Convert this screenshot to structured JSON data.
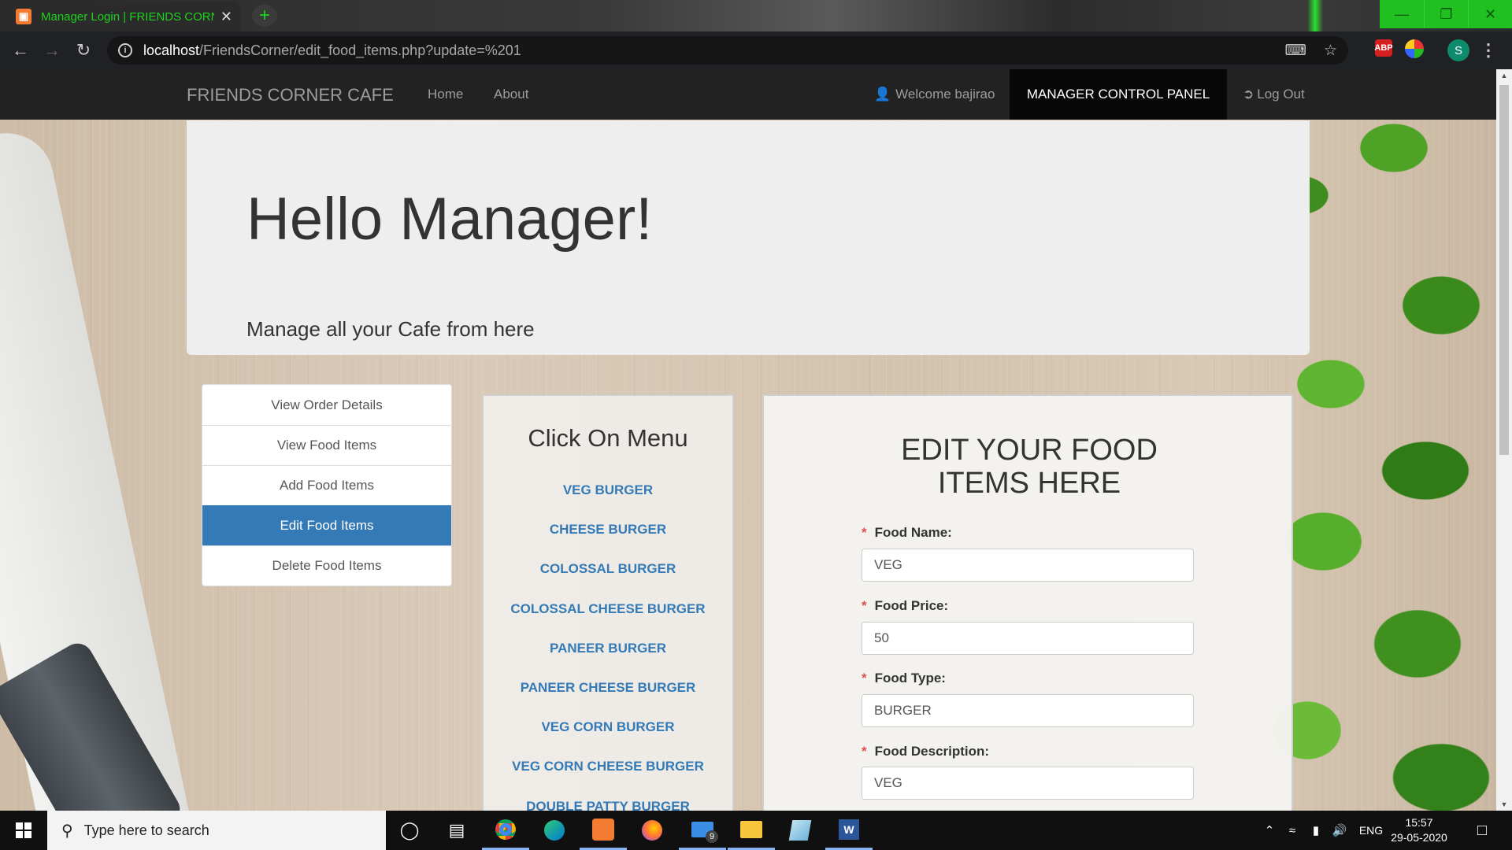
{
  "browser": {
    "tab_title": "Manager Login | FRIENDS CORNER",
    "tab_favicon": "xampp-icon",
    "new_tab_symbol": "+",
    "url_host": "localhost",
    "url_path": "/FriendsCorner/edit_food_items.php?update=%201",
    "extensions": {
      "abp_label": "ABP",
      "profile_initial": "S"
    },
    "accent_color": "#20c020"
  },
  "navbar": {
    "brand": "FRIENDS CORNER CAFE",
    "links": [
      "Home",
      "About"
    ],
    "welcome": "Welcome bajirao",
    "control_panel": "MANAGER CONTROL PANEL",
    "logout": "Log Out"
  },
  "jumbotron": {
    "heading": "Hello Manager!",
    "subtext": "Manage all your Cafe from here"
  },
  "sidebar": {
    "items": [
      {
        "label": "View Order Details",
        "active": false
      },
      {
        "label": "View Food Items",
        "active": false
      },
      {
        "label": "Add Food Items",
        "active": false
      },
      {
        "label": "Edit Food Items",
        "active": true
      },
      {
        "label": "Delete Food Items",
        "active": false
      }
    ],
    "active_color": "#337ab7"
  },
  "menu_panel": {
    "title": "Click On Menu",
    "items": [
      "VEG BURGER",
      "CHEESE BURGER",
      "COLOSSAL BURGER",
      "COLOSSAL CHEESE BURGER",
      "PANEER BURGER",
      "PANEER CHEESE BURGER",
      "VEG CORN BURGER",
      "VEG CORN CHEESE BURGER",
      "DOUBLE PATTY BURGER"
    ]
  },
  "edit_form": {
    "title_line1": "EDIT YOUR FOOD",
    "title_line2": "ITEMS HERE",
    "required_marker": "*",
    "fields": [
      {
        "label": "Food Name:",
        "value": "VEG"
      },
      {
        "label": "Food Price:",
        "value": "50"
      },
      {
        "label": "Food Type:",
        "value": "BURGER"
      },
      {
        "label": "Food Description:",
        "value": "VEG"
      }
    ]
  },
  "taskbar": {
    "search_placeholder": "Type here to search",
    "mail_badge": "9",
    "language": "ENG",
    "time": "15:57",
    "date": "29-05-2020"
  }
}
